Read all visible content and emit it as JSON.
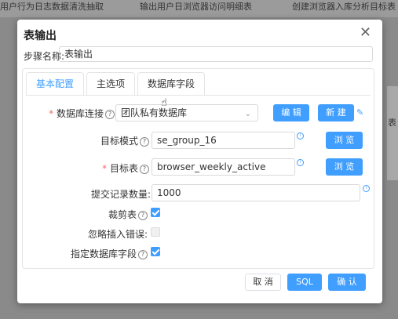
{
  "background": {
    "tabs": [
      "用户行为日志数据清洗抽取",
      "输出用户日浏览器访问明细表",
      "创建浏览器入库分析目标表"
    ],
    "right_label": "表"
  },
  "dialog": {
    "title": "表输出",
    "step_name_label": "步骤名称:",
    "step_name_value": "表输出",
    "tabs": [
      "基本配置",
      "主选项",
      "数据库字段"
    ],
    "active_tab": 0,
    "db_connection": {
      "label": "数据库连接",
      "value": "团队私有数据库",
      "edit_btn": "编 辑",
      "new_btn": "新 建"
    },
    "target_schema": {
      "label": "目标模式",
      "value": "se_group_16",
      "browse_btn": "浏 览"
    },
    "target_table": {
      "label": "目标表",
      "value": "browser_weekly_active",
      "browse_btn": "浏 览"
    },
    "commit_size": {
      "label": "提交记录数量:",
      "value": "1000"
    },
    "truncate_table": {
      "label": "裁剪表",
      "checked": true
    },
    "ignore_insert_errors": {
      "label": "忽略插入错误:",
      "checked": false
    },
    "specify_db_fields": {
      "label": "指定数据库字段",
      "checked": true
    },
    "footer": {
      "cancel": "取 消",
      "sql": "SQL",
      "confirm": "确 认"
    },
    "accent_color": "#409eff"
  }
}
